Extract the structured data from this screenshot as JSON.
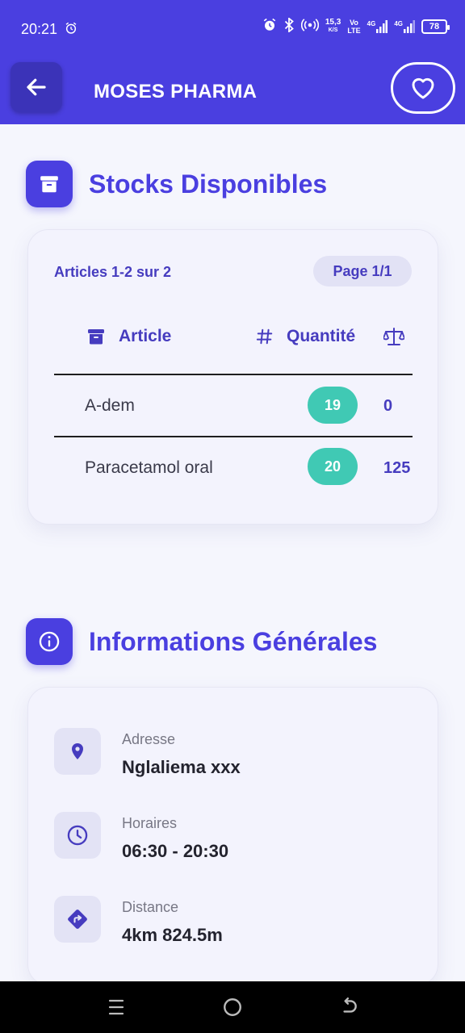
{
  "status_bar": {
    "time": "20:21",
    "net_speed_value": "15,3",
    "net_speed_unit": "K/S",
    "volte_top": "Vo",
    "volte_bottom": "LTE",
    "sim1": "4G",
    "sim2": "4G",
    "battery": "78"
  },
  "app_bar": {
    "title": "MOSES PHARMA"
  },
  "stocks": {
    "title": "Stocks Disponibles",
    "count_text": "Articles 1-2 sur 2",
    "page_text": "Page 1/1",
    "headers": {
      "article": "Article",
      "quantity": "Quantité"
    },
    "rows": [
      {
        "name": "A-dem",
        "quantity": "19",
        "weight": "0"
      },
      {
        "name": "Paracetamol oral",
        "quantity": "20",
        "weight": "125"
      }
    ]
  },
  "info": {
    "title": "Informations Générales",
    "address_label": "Adresse",
    "address_value": "Nglaliema xxx",
    "hours_label": "Horaires",
    "hours_value": "06:30 - 20:30",
    "distance_label": "Distance",
    "distance_value": "4km 824.5m"
  },
  "colors": {
    "primary": "#4a3fe0",
    "accent_teal": "#40c9b4",
    "background": "#f5f6fd"
  },
  "icons": [
    "back-arrow-icon",
    "heart-icon",
    "archive-box-icon",
    "hash-icon",
    "scale-icon",
    "info-icon",
    "location-pin-icon",
    "clock-icon",
    "directions-icon"
  ]
}
